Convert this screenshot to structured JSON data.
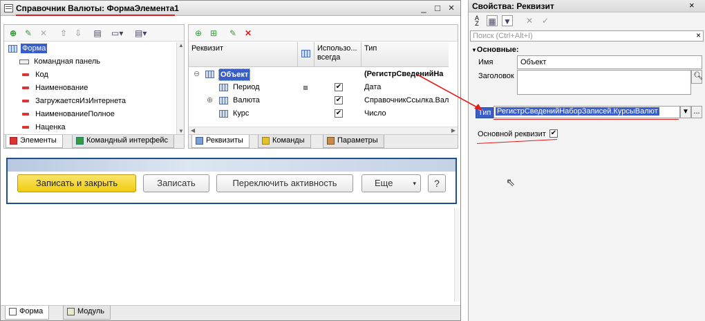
{
  "window": {
    "title": "Справочник Валюты: ФормаЭлемента1",
    "minimize": "_",
    "maximize": "□",
    "close": "×"
  },
  "elements_tree": {
    "items": [
      {
        "label": "Форма",
        "icon": "form-icon"
      },
      {
        "label": "Командная панель",
        "icon": "command-panel-icon"
      },
      {
        "label": "Код",
        "icon": "field-icon"
      },
      {
        "label": "Наименование",
        "icon": "field-icon"
      },
      {
        "label": "ЗагружаетсяИзИнтернета",
        "icon": "field-icon"
      },
      {
        "label": "НаименованиеПолное",
        "icon": "field-icon"
      },
      {
        "label": "Наценка",
        "icon": "field-icon"
      }
    ]
  },
  "requisites": {
    "headers": {
      "name": "Реквизит",
      "use": "Использо... всегда",
      "type": "Тип"
    },
    "rows": [
      {
        "name": "Объект",
        "type": "(РегистрСведенийНа",
        "checked": false,
        "level": 0,
        "bold": true,
        "selected": true,
        "expand": "⊖"
      },
      {
        "name": "Период",
        "type": "Дата",
        "checked": true,
        "level": 1,
        "bold": false,
        "selected": false,
        "expand": ""
      },
      {
        "name": "Валюта",
        "type": "СправочникСсылка.Вал",
        "checked": true,
        "level": 1,
        "bold": false,
        "selected": false,
        "expand": "⊕"
      },
      {
        "name": "Курс",
        "type": "Число",
        "checked": true,
        "level": 1,
        "bold": false,
        "selected": false,
        "expand": ""
      }
    ]
  },
  "tabs_left": {
    "elements": "Элементы",
    "command_interface": "Командный интерфейс"
  },
  "tabs_mid": {
    "requisites": "Реквизиты",
    "commands": "Команды",
    "parameters": "Параметры"
  },
  "form_preview": {
    "save_close": "Записать и закрыть",
    "save": "Записать",
    "toggle": "Переключить активность",
    "more": "Еще",
    "help": "?"
  },
  "bottom_tabs": {
    "form": "Форма",
    "module": "Модуль"
  },
  "properties": {
    "title": "Свойства: Реквизит",
    "search_placeholder": "Поиск (Ctrl+Alt+I)",
    "section": "Основные:",
    "name_label": "Имя",
    "name_value": "Объект",
    "caption_label": "Заголовок",
    "type_label": "Тип",
    "type_value": "РегистрСведенийНаборЗаписей.КурсыВалют",
    "main_requisite_label": "Основной реквизит",
    "ellipsis": "..."
  },
  "colors": {
    "accent_yellow": "#f5d21f",
    "selection_blue": "#3a5ec9",
    "annotation_red": "#e31b1b"
  }
}
